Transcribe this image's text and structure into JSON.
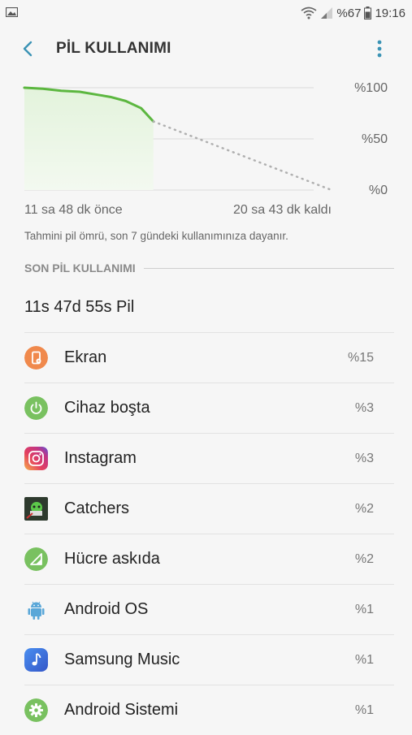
{
  "status": {
    "battery_text": "%67",
    "time": "19:16",
    "icons": [
      "gallery-icon",
      "wifi-icon",
      "signal-icon",
      "battery-icon"
    ]
  },
  "header": {
    "title": "PİL KULLANIMI",
    "back_icon": "back-arrow-icon",
    "more_icon": "more-vertical-icon"
  },
  "chart_data": {
    "type": "area",
    "y_tick_labels": [
      "%100",
      "%50",
      "%0"
    ],
    "x_left_label": "11 sa 48 dk önce",
    "x_right_label": "20 sa 43 dk kaldı",
    "ylim": [
      0,
      100
    ],
    "xlim": [
      0,
      1
    ],
    "x": [
      0.0,
      0.06,
      0.12,
      0.18,
      0.24,
      0.28,
      0.33,
      0.38,
      0.42
    ],
    "y": [
      100,
      99,
      97,
      96,
      93,
      91,
      87,
      80,
      67
    ],
    "projection": {
      "x": [
        0.42,
        1.0
      ],
      "y": [
        67,
        0
      ]
    },
    "grid": true,
    "colors": {
      "line": "#5cb740",
      "fill": "#e3f3dc",
      "projection": "#b0b0b0",
      "grid": "#d9d9d9"
    }
  },
  "note": "Tahmini pil ömrü, son 7 gündeki kullanımınıza dayanır.",
  "section_title": "SON PİL KULLANIMI",
  "total_time": "11s 47d 55s Pil",
  "items": [
    {
      "label": "Ekran",
      "percent": "%15",
      "icon": "screen-icon",
      "color": "#f0894c"
    },
    {
      "label": "Cihaz boşta",
      "percent": "%3",
      "icon": "power-icon",
      "color": "#79c160"
    },
    {
      "label": "Instagram",
      "percent": "%3",
      "icon": "instagram-icon",
      "color": "#c13584"
    },
    {
      "label": "Catchers",
      "percent": "%2",
      "icon": "catchers-icon",
      "color": "#2e3a2e"
    },
    {
      "label": "Hücre askıda",
      "percent": "%2",
      "icon": "cell-signal-icon",
      "color": "#79c160"
    },
    {
      "label": "Android OS",
      "percent": "%1",
      "icon": "android-icon",
      "color": "#5aa7d8"
    },
    {
      "label": "Samsung Music",
      "percent": "%1",
      "icon": "music-icon",
      "color": "#3d7ee8"
    },
    {
      "label": "Android Sistemi",
      "percent": "%1",
      "icon": "settings-gear-icon",
      "color": "#79c160"
    }
  ]
}
